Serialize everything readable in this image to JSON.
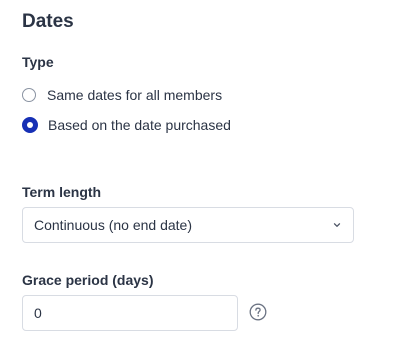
{
  "section": {
    "title": "Dates"
  },
  "type_field": {
    "label": "Type",
    "options": [
      {
        "label": "Same dates for all members",
        "selected": false
      },
      {
        "label": "Based on the date purchased",
        "selected": true
      }
    ]
  },
  "term_length": {
    "label": "Term length",
    "selected_value": "Continuous (no end date)",
    "icon": "chevron-down-icon"
  },
  "grace_period": {
    "label": "Grace period (days)",
    "value": "0",
    "help_icon": "question-circle-icon"
  },
  "colors": {
    "accent": "#1730b5",
    "text": "#2b3445",
    "border": "#d8dce3"
  }
}
